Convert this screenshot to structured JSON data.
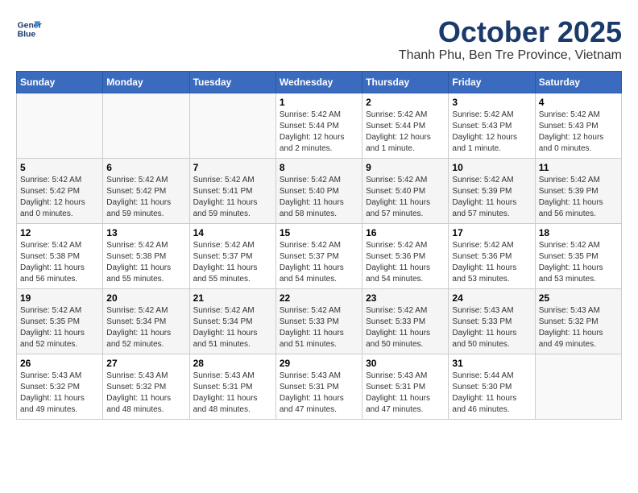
{
  "header": {
    "logo_line1": "General",
    "logo_line2": "Blue",
    "month_title": "October 2025",
    "location": "Thanh Phu, Ben Tre Province, Vietnam"
  },
  "days_of_week": [
    "Sunday",
    "Monday",
    "Tuesday",
    "Wednesday",
    "Thursday",
    "Friday",
    "Saturday"
  ],
  "weeks": [
    [
      {
        "day": "",
        "info": ""
      },
      {
        "day": "",
        "info": ""
      },
      {
        "day": "",
        "info": ""
      },
      {
        "day": "1",
        "info": "Sunrise: 5:42 AM\nSunset: 5:44 PM\nDaylight: 12 hours\nand 2 minutes."
      },
      {
        "day": "2",
        "info": "Sunrise: 5:42 AM\nSunset: 5:44 PM\nDaylight: 12 hours\nand 1 minute."
      },
      {
        "day": "3",
        "info": "Sunrise: 5:42 AM\nSunset: 5:43 PM\nDaylight: 12 hours\nand 1 minute."
      },
      {
        "day": "4",
        "info": "Sunrise: 5:42 AM\nSunset: 5:43 PM\nDaylight: 12 hours\nand 0 minutes."
      }
    ],
    [
      {
        "day": "5",
        "info": "Sunrise: 5:42 AM\nSunset: 5:42 PM\nDaylight: 12 hours\nand 0 minutes."
      },
      {
        "day": "6",
        "info": "Sunrise: 5:42 AM\nSunset: 5:42 PM\nDaylight: 11 hours\nand 59 minutes."
      },
      {
        "day": "7",
        "info": "Sunrise: 5:42 AM\nSunset: 5:41 PM\nDaylight: 11 hours\nand 59 minutes."
      },
      {
        "day": "8",
        "info": "Sunrise: 5:42 AM\nSunset: 5:40 PM\nDaylight: 11 hours\nand 58 minutes."
      },
      {
        "day": "9",
        "info": "Sunrise: 5:42 AM\nSunset: 5:40 PM\nDaylight: 11 hours\nand 57 minutes."
      },
      {
        "day": "10",
        "info": "Sunrise: 5:42 AM\nSunset: 5:39 PM\nDaylight: 11 hours\nand 57 minutes."
      },
      {
        "day": "11",
        "info": "Sunrise: 5:42 AM\nSunset: 5:39 PM\nDaylight: 11 hours\nand 56 minutes."
      }
    ],
    [
      {
        "day": "12",
        "info": "Sunrise: 5:42 AM\nSunset: 5:38 PM\nDaylight: 11 hours\nand 56 minutes."
      },
      {
        "day": "13",
        "info": "Sunrise: 5:42 AM\nSunset: 5:38 PM\nDaylight: 11 hours\nand 55 minutes."
      },
      {
        "day": "14",
        "info": "Sunrise: 5:42 AM\nSunset: 5:37 PM\nDaylight: 11 hours\nand 55 minutes."
      },
      {
        "day": "15",
        "info": "Sunrise: 5:42 AM\nSunset: 5:37 PM\nDaylight: 11 hours\nand 54 minutes."
      },
      {
        "day": "16",
        "info": "Sunrise: 5:42 AM\nSunset: 5:36 PM\nDaylight: 11 hours\nand 54 minutes."
      },
      {
        "day": "17",
        "info": "Sunrise: 5:42 AM\nSunset: 5:36 PM\nDaylight: 11 hours\nand 53 minutes."
      },
      {
        "day": "18",
        "info": "Sunrise: 5:42 AM\nSunset: 5:35 PM\nDaylight: 11 hours\nand 53 minutes."
      }
    ],
    [
      {
        "day": "19",
        "info": "Sunrise: 5:42 AM\nSunset: 5:35 PM\nDaylight: 11 hours\nand 52 minutes."
      },
      {
        "day": "20",
        "info": "Sunrise: 5:42 AM\nSunset: 5:34 PM\nDaylight: 11 hours\nand 52 minutes."
      },
      {
        "day": "21",
        "info": "Sunrise: 5:42 AM\nSunset: 5:34 PM\nDaylight: 11 hours\nand 51 minutes."
      },
      {
        "day": "22",
        "info": "Sunrise: 5:42 AM\nSunset: 5:33 PM\nDaylight: 11 hours\nand 51 minutes."
      },
      {
        "day": "23",
        "info": "Sunrise: 5:42 AM\nSunset: 5:33 PM\nDaylight: 11 hours\nand 50 minutes."
      },
      {
        "day": "24",
        "info": "Sunrise: 5:43 AM\nSunset: 5:33 PM\nDaylight: 11 hours\nand 50 minutes."
      },
      {
        "day": "25",
        "info": "Sunrise: 5:43 AM\nSunset: 5:32 PM\nDaylight: 11 hours\nand 49 minutes."
      }
    ],
    [
      {
        "day": "26",
        "info": "Sunrise: 5:43 AM\nSunset: 5:32 PM\nDaylight: 11 hours\nand 49 minutes."
      },
      {
        "day": "27",
        "info": "Sunrise: 5:43 AM\nSunset: 5:32 PM\nDaylight: 11 hours\nand 48 minutes."
      },
      {
        "day": "28",
        "info": "Sunrise: 5:43 AM\nSunset: 5:31 PM\nDaylight: 11 hours\nand 48 minutes."
      },
      {
        "day": "29",
        "info": "Sunrise: 5:43 AM\nSunset: 5:31 PM\nDaylight: 11 hours\nand 47 minutes."
      },
      {
        "day": "30",
        "info": "Sunrise: 5:43 AM\nSunset: 5:31 PM\nDaylight: 11 hours\nand 47 minutes."
      },
      {
        "day": "31",
        "info": "Sunrise: 5:44 AM\nSunset: 5:30 PM\nDaylight: 11 hours\nand 46 minutes."
      },
      {
        "day": "",
        "info": ""
      }
    ]
  ]
}
